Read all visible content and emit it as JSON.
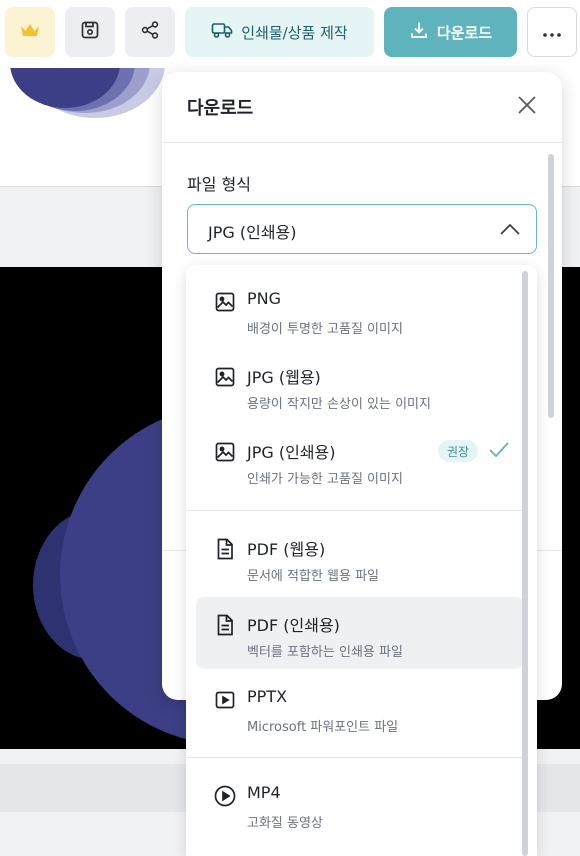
{
  "toolbar": {
    "print_label": "인쇄물/상품 제작",
    "download_label": "다운로드"
  },
  "panel": {
    "title": "다운로드",
    "format_label": "파일 형식",
    "selected_format": "JPG (인쇄용)"
  },
  "formats": [
    {
      "name": "PNG",
      "desc": "배경이 투명한 고품질 이미지",
      "icon": "image-icon"
    },
    {
      "name": "JPG (웹용)",
      "desc": "용량이 작지만 손상이 있는 이미지",
      "icon": "image-icon"
    },
    {
      "name": "JPG (인쇄용)",
      "desc": "인쇄가 가능한 고품질 이미지",
      "icon": "image-icon",
      "badge": "권장",
      "selected": true
    },
    {
      "name": "PDF (웹용)",
      "desc": "문서에 적합한 웹용 파일",
      "icon": "document-icon"
    },
    {
      "name": "PDF (인쇄용)",
      "desc": "벡터를 포함하는 인쇄용 파일",
      "icon": "document-icon",
      "hovered": true
    },
    {
      "name": "PPTX",
      "desc": "Microsoft 파워포인트 파일",
      "icon": "presentation-icon"
    },
    {
      "name": "MP4",
      "desc": "고화질 동영상",
      "icon": "play-circle-icon"
    }
  ],
  "colors": {
    "accent": "#5fb3bd",
    "accent_light": "#e5f4f5",
    "crown": "#f2c232",
    "shape": "#3c3f85"
  }
}
